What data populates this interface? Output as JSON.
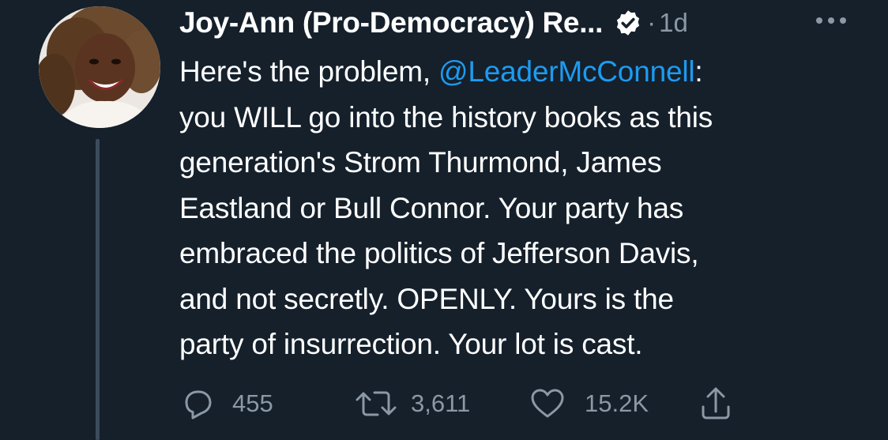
{
  "tweet": {
    "author": {
      "display_name": "Joy-Ann (Pro-Democracy) Re...",
      "verified_icon": "verified-badge-icon"
    },
    "separator": "·",
    "timestamp": "1d",
    "more_icon": "more-horizontal-icon",
    "text": {
      "line1_prefix": "Here's the problem, ",
      "mention": "@LeaderMcConnell",
      "line1_suffix": ":",
      "line2": "you WILL go into the history books as this",
      "line3": "generation's Strom Thurmond, James",
      "line4": "Eastland or Bull Connor. Your party has",
      "line5": "embraced the politics of Jefferson Davis,",
      "line6": "and not secretly. OPENLY. Yours is the",
      "line7": "party of insurrection. Your lot is cast."
    },
    "actions": {
      "reply": {
        "icon": "reply-icon",
        "count": "455"
      },
      "retweet": {
        "icon": "retweet-icon",
        "count": "3,611"
      },
      "like": {
        "icon": "heart-icon",
        "count": "15.2K"
      },
      "share": {
        "icon": "share-icon"
      }
    }
  },
  "colors": {
    "background": "#15202b",
    "text": "#ffffff",
    "secondary": "#8b98a5",
    "mention": "#1d9bf0",
    "thread_line": "#3d4c5c"
  }
}
